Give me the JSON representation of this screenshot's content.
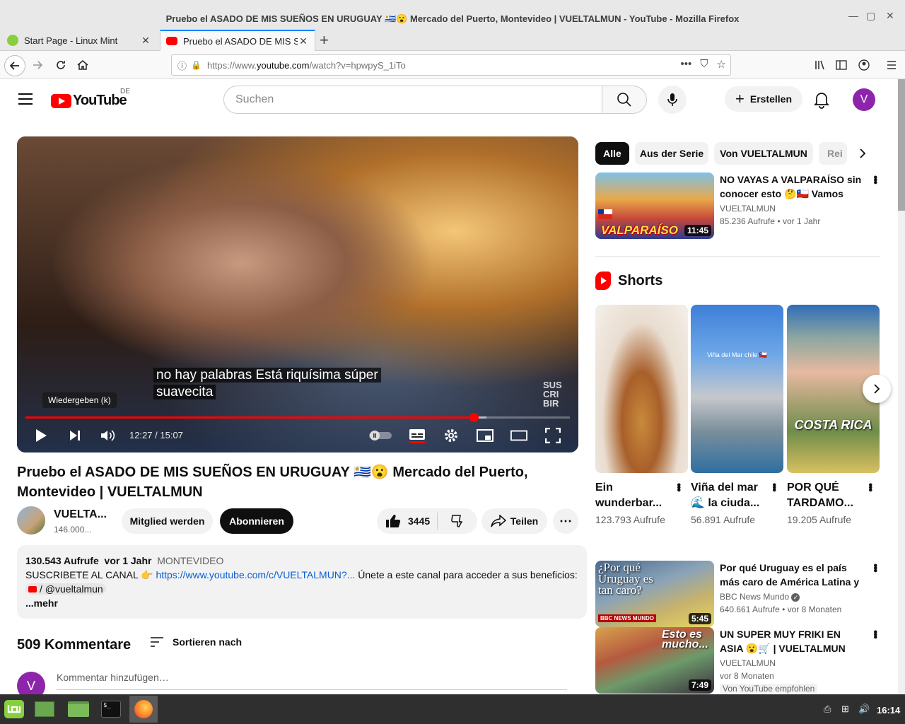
{
  "window": {
    "title": "Pruebo el ASADO DE MIS SUEÑOS EN URUGUAY 🇺🇾😮 Mercado del Puerto, Montevideo | VUELTALMUN - YouTube - Mozilla Firefox",
    "controls": [
      "minimize",
      "maximize",
      "close"
    ]
  },
  "tabs": [
    {
      "label": "Start Page - Linux Mint",
      "icon": "linux-mint-icon",
      "active": false
    },
    {
      "label": "Pruebo el ASADO DE MIS SUEÑOS",
      "icon": "youtube-icon",
      "active": true
    }
  ],
  "address": {
    "prefix": "https://www.",
    "domain": "youtube.com",
    "path": "/watch?v=hpwpyS_1iTo"
  },
  "youtube": {
    "logo_text": "YouTube",
    "country": "DE",
    "search_placeholder": "Suchen",
    "create_label": "Erstellen",
    "avatar_letter": "V"
  },
  "player": {
    "subtitle": "no hay palabras Está riquísima súper suavecita",
    "tooltip": "Wiedergeben (k)",
    "time": "12:27 / 15:07",
    "progress": 0.824,
    "buffered": 0.847,
    "watermark": "SUS CRI BIR",
    "overlay_handle": "@vueltalmun"
  },
  "video": {
    "title": "Pruebo el ASADO DE MIS SUEÑOS EN URUGUAY 🇺🇾😮 Mercado del Puerto, Montevideo | VUELTALMUN",
    "channel": "VUELTA...",
    "subs": "146.000...",
    "join_label": "Mitglied werden",
    "subscribe_label": "Abonnieren",
    "likes": "3445",
    "share_label": "Teilen",
    "description": {
      "views": "130.543 Aufrufe",
      "age": "vor 1 Jahr",
      "location": "MONTEVIDEO",
      "line1_text": "SUSCRIBETE AL CANAL 👉 ",
      "line1_link": "https://www.youtube.com/c/VUELTALMUN?...",
      "line1_tail": " Únete a este canal para acceder a sus beneficios:",
      "handle": "/ @vueltalmun",
      "more": "...mehr"
    },
    "comments_count": "509 Kommentare",
    "sort_label": "Sortieren nach",
    "comment_placeholder": "Kommentar hinzufügen…",
    "comment_avatar": "V"
  },
  "chips": [
    "Alle",
    "Aus der Serie",
    "Von VUELTALMUN",
    "Rei"
  ],
  "recommendations": [
    {
      "title": "NO VAYAS A VALPARAÍSO sin conocer esto 🤔🇨🇱 Vamos del...",
      "channel": "VUELTALMUN",
      "views": "85.236 Aufrufe",
      "age": "• vor 1 Jahr",
      "duration": "11:45",
      "thumb_text": "VALPARAÍSO"
    },
    {
      "title": "Por qué Uruguay es el país más caro de América Latina y uno ...",
      "channel": "BBC News Mundo",
      "verified": true,
      "views": "640.661 Aufrufe",
      "age": "• vor 8 Monaten",
      "duration": "5:45",
      "thumb_text": "¿Por qué Uruguay es tan caro?",
      "thumb_badge": "BBC NEWS MUNDO"
    },
    {
      "title": "UN SUPER MUY FRIKI EN ASIA 😮🛒 | VUELTALMUN",
      "channel": "VUELTALMUN",
      "views": "vor 8 Monaten",
      "badge": "Von YouTube empfohlen",
      "duration": "7:49",
      "thumb_text": "Esto es mucho..."
    }
  ],
  "shorts": {
    "heading": "Shorts",
    "items": [
      {
        "title": "Ein wunderbar...",
        "views": "123.793 Aufrufe"
      },
      {
        "title": "Viña del mar 🌊 la ciuda...",
        "views": "56.891 Aufrufe",
        "thumb_text": "Viña del Mar chile 🇨🇱"
      },
      {
        "title": "POR QUÉ TARDAMO...",
        "views": "19.205 Aufrufe",
        "thumb_text": "COSTA RICA"
      }
    ]
  },
  "taskbar": {
    "clock": "16:14"
  }
}
